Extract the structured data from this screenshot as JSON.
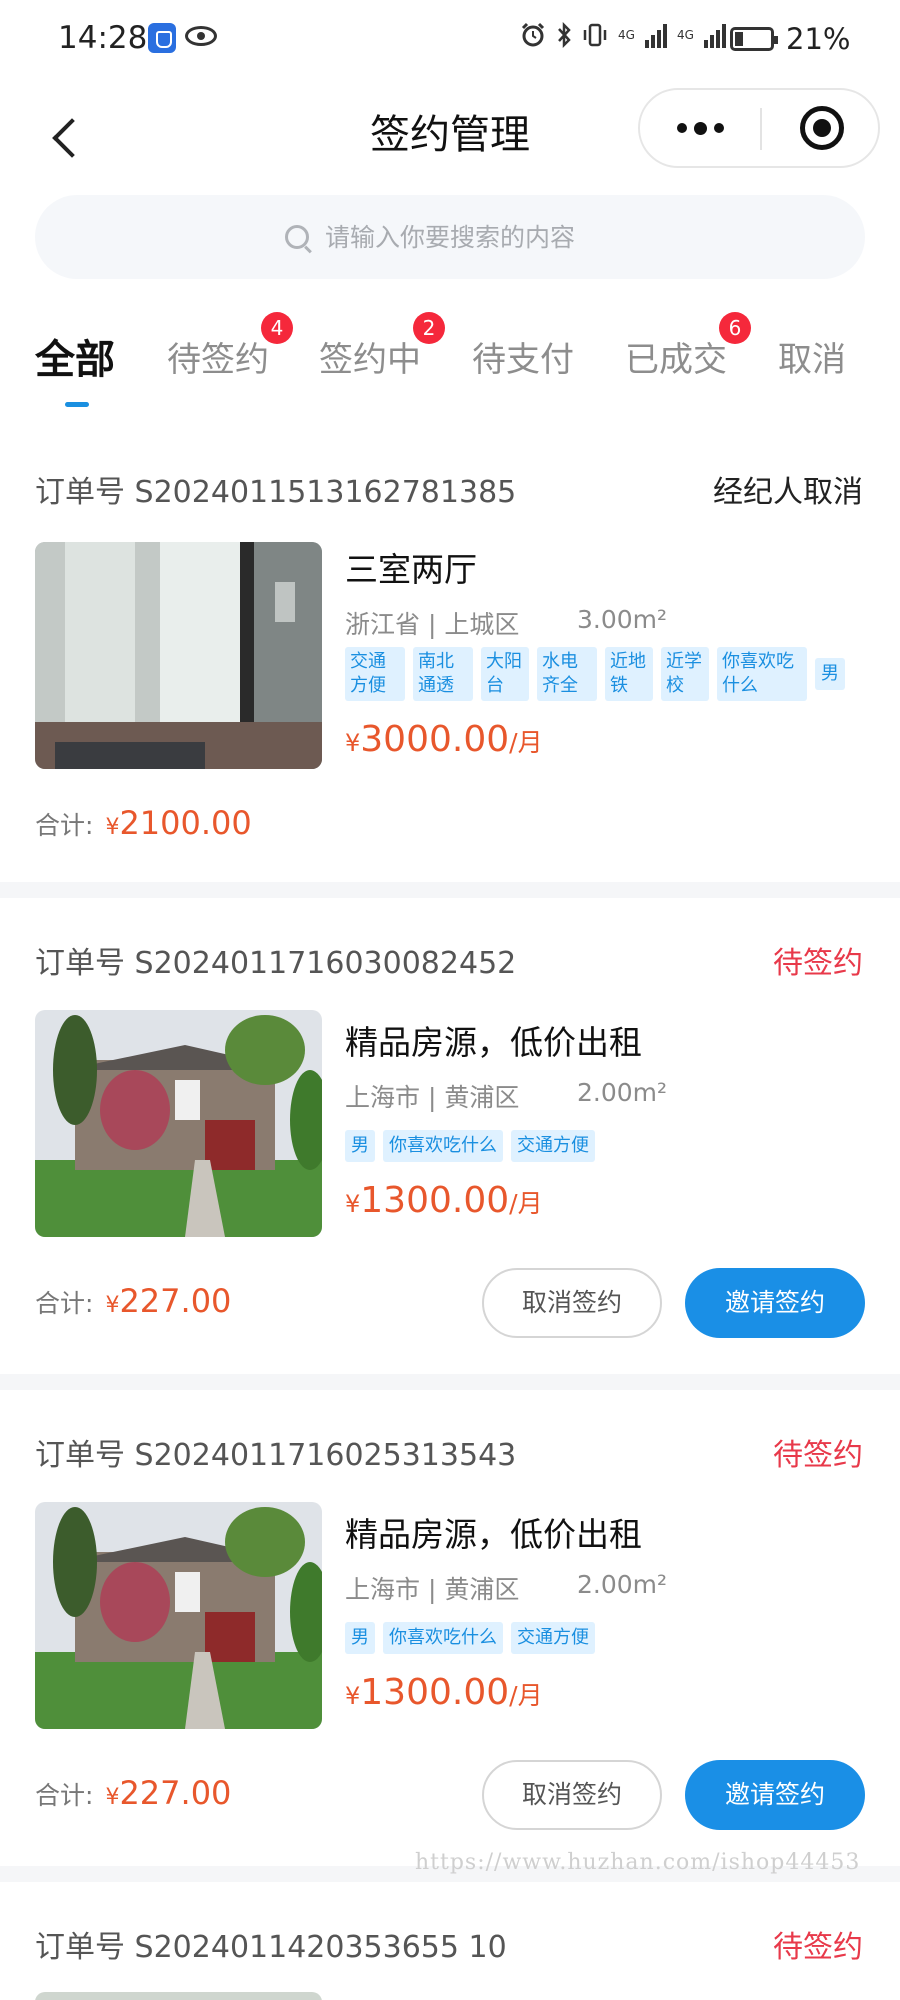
{
  "status_bar": {
    "time": "14:28",
    "battery": "21%",
    "net1": "4G",
    "net2": "4G",
    "icons": [
      "shield-app-icon",
      "eye-icon",
      "alarm-icon",
      "bluetooth-icon",
      "vibrate-icon",
      "signal-icon",
      "battery-icon"
    ]
  },
  "nav": {
    "title": "签约管理",
    "back_icon": "chevron-left-icon",
    "more_icon": "more-dots-icon",
    "target_icon": "target-icon"
  },
  "search": {
    "placeholder": "请输入你要搜索的内容",
    "value": ""
  },
  "tabs": [
    {
      "label": "全部",
      "badge": ""
    },
    {
      "label": "待签约",
      "badge": "4"
    },
    {
      "label": "签约中",
      "badge": "2"
    },
    {
      "label": "待支付",
      "badge": ""
    },
    {
      "label": "已成交",
      "badge": "6"
    },
    {
      "label": "取消",
      "badge": ""
    }
  ],
  "colors": {
    "accent": "#1a8fe6",
    "pending_status": "#e8394a",
    "price": "#e8572c",
    "badge": "#f5283b"
  },
  "orders": [
    {
      "order_prefix": "订单号",
      "order_no": "S2024011513162781385",
      "status": "经纪人取消",
      "title": "三室两厅",
      "location": "浙江省 | 上城区",
      "area": "3.00m²",
      "tags": [
        "交通方便",
        "南北通透",
        "大阳台",
        "水电齐全",
        "近地铁",
        "近学校",
        "你喜欢吃什么",
        "男"
      ],
      "yen": "¥",
      "price": "3000.00",
      "unit": "/月",
      "total_label": "合计:",
      "total": "2100.00"
    },
    {
      "order_prefix": "订单号",
      "order_no": "S2024011716030082452",
      "status": "待签约",
      "title": "精品房源，低价出租",
      "location": "上海市 | 黄浦区",
      "area": "2.00m²",
      "tags": [
        "男",
        "你喜欢吃什么",
        "交通方便"
      ],
      "yen": "¥",
      "price": "1300.00",
      "unit": "/月",
      "total_label": "合计:",
      "total": "227.00",
      "cancel_label": "取消签约",
      "invite_label": "邀请签约"
    },
    {
      "order_prefix": "订单号",
      "order_no": "S2024011716025313543",
      "status": "待签约",
      "title": "精品房源，低价出租",
      "location": "上海市 | 黄浦区",
      "area": "2.00m²",
      "tags": [
        "男",
        "你喜欢吃什么",
        "交通方便"
      ],
      "yen": "¥",
      "price": "1300.00",
      "unit": "/月",
      "total_label": "合计:",
      "total": "227.00",
      "cancel_label": "取消签约",
      "invite_label": "邀请签约"
    },
    {
      "order_prefix": "订单号",
      "order_no": "S2024011420353655 10",
      "status": "待签约"
    }
  ],
  "watermark": "https://www.huzhan.com/ishop44453"
}
